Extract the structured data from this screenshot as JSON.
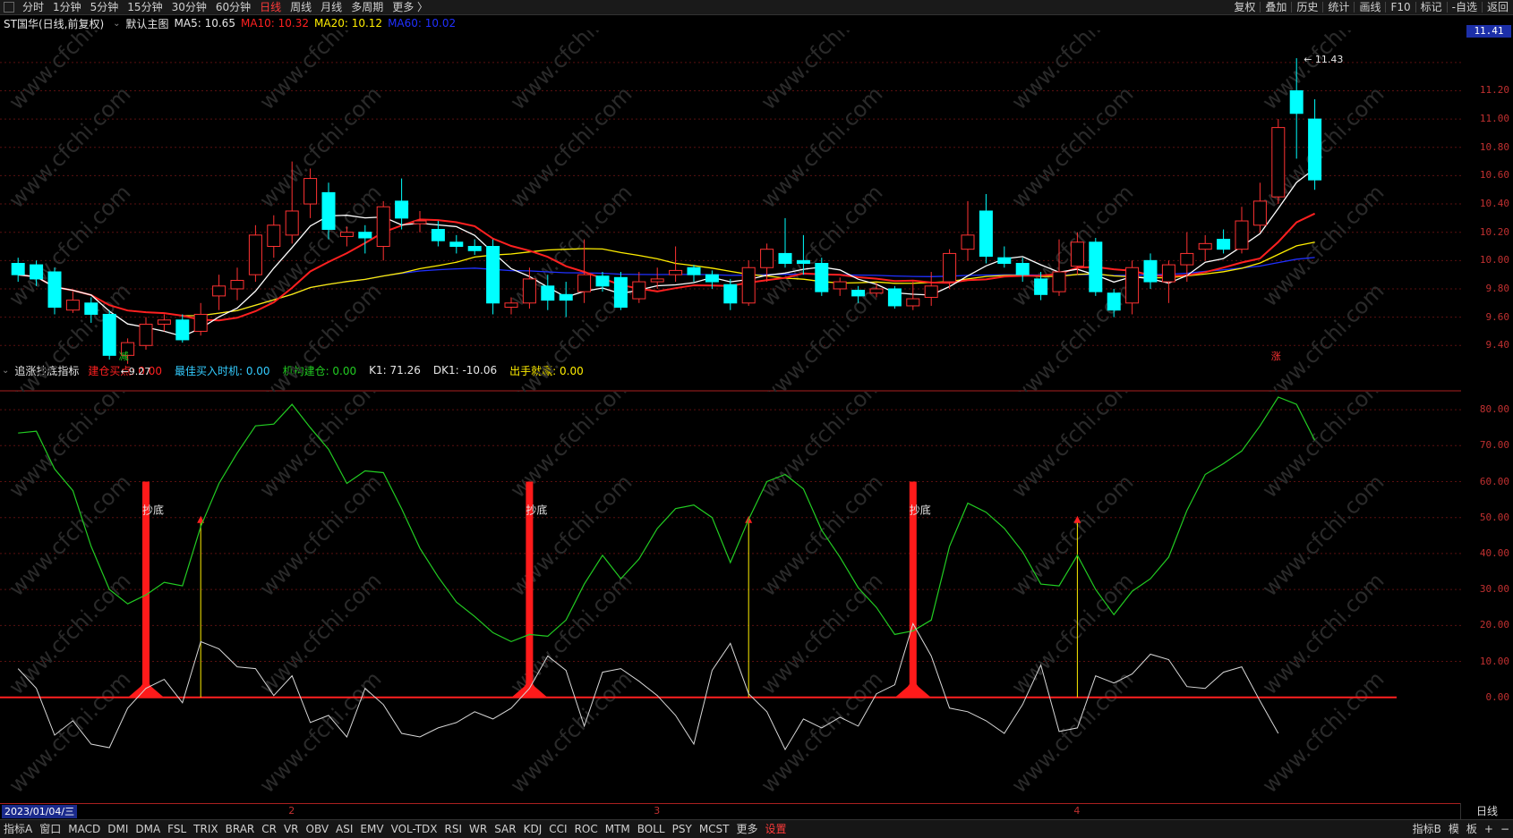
{
  "toolbar": {
    "periods": [
      {
        "label": "分时",
        "active": false
      },
      {
        "label": "1分钟",
        "active": false
      },
      {
        "label": "5分钟",
        "active": false
      },
      {
        "label": "15分钟",
        "active": false
      },
      {
        "label": "30分钟",
        "active": false
      },
      {
        "label": "60分钟",
        "active": false
      },
      {
        "label": "日线",
        "active": true
      },
      {
        "label": "周线",
        "active": false
      },
      {
        "label": "月线",
        "active": false
      },
      {
        "label": "多周期",
        "active": false
      },
      {
        "label": "更多 〉",
        "active": false
      }
    ],
    "right": [
      "复权",
      "叠加",
      "历史",
      "统计",
      "画线",
      "F10",
      "标记",
      "-自选",
      "返回"
    ]
  },
  "main_legend": {
    "stock": "ST国华(日线,前复权)",
    "main_indicator": "默认主图",
    "ma5": "MA5: 10.65",
    "ma10": "MA10: 10.32",
    "ma20": "MA20: 10.12",
    "ma60": "MA60: 10.02"
  },
  "sub_legend": {
    "name": "追涨抄底指标",
    "items": [
      {
        "text": "建仓买点: 0.00",
        "color": "#ff2020"
      },
      {
        "text": "最佳买入时机: 0.00",
        "color": "#33ccff"
      },
      {
        "text": "机构建仓: 0.00",
        "color": "#22cc22"
      },
      {
        "text": "K1: 71.26",
        "color": "#e6e6e6"
      },
      {
        "text": "DK1: -10.06",
        "color": "#e6e6e6"
      },
      {
        "text": "出手就赢: 0.00",
        "color": "#ffee00"
      }
    ]
  },
  "colors": {
    "up": "#ff3232",
    "down": "#00ffff",
    "ma5": "#ffffff",
    "ma10": "#ff2020",
    "ma20": "#ffee00",
    "ma60": "#2030ff",
    "k1": "#22cc22",
    "dk1": "#d8d8d8"
  },
  "price_axis": {
    "ticks": [
      "11.41",
      "11.20",
      "11.00",
      "10.80",
      "10.60",
      "10.40",
      "10.20",
      "10.00",
      "9.80",
      "9.60",
      "9.40"
    ],
    "current_price": "11.41"
  },
  "sub_axis": {
    "ticks": [
      "80.00",
      "70.00",
      "60.00",
      "50.00",
      "40.00",
      "30.00",
      "20.00",
      "10.00",
      "0.00"
    ]
  },
  "annotations": {
    "high_label": "11.43",
    "low_label": "9.27",
    "low_marker": "减",
    "up_marker": "涨",
    "bottom_label": "抄底"
  },
  "chart_data": {
    "type": "candlestick",
    "ylim": [
      9.25,
      11.5
    ],
    "candles": [
      [
        9.98,
        9.9,
        10.02,
        9.85
      ],
      [
        9.97,
        9.87,
        10.0,
        9.82
      ],
      [
        9.92,
        9.67,
        9.95,
        9.62
      ],
      [
        9.65,
        9.72,
        9.78,
        9.63
      ],
      [
        9.7,
        9.62,
        9.74,
        9.56
      ],
      [
        9.62,
        9.33,
        9.65,
        9.3
      ],
      [
        9.33,
        9.42,
        9.45,
        9.27
      ],
      [
        9.4,
        9.55,
        9.6,
        9.37
      ],
      [
        9.55,
        9.58,
        9.62,
        9.5
      ],
      [
        9.58,
        9.44,
        9.62,
        9.42
      ],
      [
        9.5,
        9.62,
        9.7,
        9.47
      ],
      [
        9.75,
        9.82,
        9.9,
        9.65
      ],
      [
        9.8,
        9.86,
        9.95,
        9.72
      ],
      [
        9.9,
        10.18,
        10.25,
        9.85
      ],
      [
        10.1,
        10.25,
        10.32,
        10.02
      ],
      [
        10.18,
        10.35,
        10.7,
        10.12
      ],
      [
        10.4,
        10.58,
        10.65,
        10.3
      ],
      [
        10.48,
        10.22,
        10.55,
        10.15
      ],
      [
        10.17,
        10.2,
        10.24,
        10.1
      ],
      [
        10.2,
        10.16,
        10.25,
        10.05
      ],
      [
        10.1,
        10.38,
        10.42,
        10.0
      ],
      [
        10.42,
        10.3,
        10.58,
        10.22
      ],
      [
        10.26,
        10.28,
        10.35,
        10.2
      ],
      [
        10.22,
        10.14,
        10.28,
        10.1
      ],
      [
        10.13,
        10.1,
        10.18,
        10.05
      ],
      [
        10.1,
        10.07,
        10.15,
        10.04
      ],
      [
        10.1,
        9.7,
        10.15,
        9.62
      ],
      [
        9.67,
        9.7,
        9.74,
        9.62
      ],
      [
        9.7,
        9.87,
        9.95,
        9.66
      ],
      [
        9.82,
        9.72,
        9.9,
        9.65
      ],
      [
        9.76,
        9.72,
        9.85,
        9.6
      ],
      [
        9.78,
        9.9,
        10.15,
        9.7
      ],
      [
        9.89,
        9.82,
        9.92,
        9.78
      ],
      [
        9.88,
        9.67,
        9.92,
        9.65
      ],
      [
        9.73,
        9.85,
        9.92,
        9.7
      ],
      [
        9.85,
        9.87,
        9.95,
        9.8
      ],
      [
        9.9,
        9.93,
        10.1,
        9.85
      ],
      [
        9.95,
        9.9,
        9.97,
        9.85
      ],
      [
        9.9,
        9.85,
        9.93,
        9.8
      ],
      [
        9.83,
        9.7,
        9.87,
        9.65
      ],
      [
        9.7,
        9.95,
        10.0,
        9.68
      ],
      [
        9.95,
        10.08,
        10.12,
        9.85
      ],
      [
        10.05,
        9.98,
        10.3,
        9.95
      ],
      [
        10.0,
        9.98,
        10.18,
        9.9
      ],
      [
        9.98,
        9.78,
        10.02,
        9.75
      ],
      [
        9.8,
        9.85,
        9.88,
        9.75
      ],
      [
        9.79,
        9.75,
        9.82,
        9.7
      ],
      [
        9.77,
        9.8,
        9.84,
        9.74
      ],
      [
        9.8,
        9.68,
        9.82,
        9.66
      ],
      [
        9.68,
        9.73,
        9.85,
        9.65
      ],
      [
        9.74,
        9.82,
        9.92,
        9.68
      ],
      [
        9.85,
        10.05,
        10.08,
        9.8
      ],
      [
        10.08,
        10.18,
        10.42,
        10.0
      ],
      [
        10.35,
        10.03,
        10.47,
        9.98
      ],
      [
        10.02,
        9.98,
        10.1,
        9.95
      ],
      [
        9.98,
        9.9,
        10.02,
        9.85
      ],
      [
        9.87,
        9.76,
        9.92,
        9.72
      ],
      [
        9.78,
        9.92,
        10.15,
        9.75
      ],
      [
        9.96,
        10.13,
        10.2,
        9.9
      ],
      [
        10.13,
        9.78,
        10.16,
        9.75
      ],
      [
        9.77,
        9.65,
        9.8,
        9.6
      ],
      [
        9.7,
        9.95,
        10.0,
        9.62
      ],
      [
        10.0,
        9.85,
        10.05,
        9.8
      ],
      [
        9.85,
        9.97,
        10.0,
        9.7
      ],
      [
        9.97,
        10.05,
        10.2,
        9.85
      ],
      [
        10.08,
        10.12,
        10.18,
        10.0
      ],
      [
        10.15,
        10.08,
        10.22,
        10.05
      ],
      [
        10.08,
        10.28,
        10.38,
        10.05
      ],
      [
        10.25,
        10.42,
        10.55,
        10.2
      ],
      [
        10.45,
        10.94,
        11.0,
        10.4
      ],
      [
        11.2,
        11.04,
        11.43,
        10.72
      ],
      [
        11.0,
        10.57,
        11.14,
        10.5
      ]
    ],
    "k1": [
      73.5,
      74,
      63.5,
      57.5,
      42,
      30,
      26,
      28.5,
      32,
      31,
      47.5,
      59.5,
      68,
      75.5,
      76,
      81.5,
      75,
      69,
      59.5,
      63,
      62.5,
      52.5,
      41.5,
      33.5,
      26.5,
      22.5,
      18,
      15.5,
      17.5,
      17,
      21.5,
      31.5,
      39.5,
      33,
      38.5,
      47,
      52.5,
      53.5,
      50,
      37.5,
      49.5,
      60,
      62,
      58,
      46.5,
      39,
      30.5,
      25,
      17.5,
      18.5,
      21.5,
      42,
      54,
      51.5,
      47,
      40.5,
      31.5,
      31,
      39.5,
      30,
      23,
      29.5,
      33,
      39,
      52,
      62,
      65,
      68.5,
      75.5,
      83.5,
      81.5,
      71.5
    ],
    "dk1": [
      8,
      2.5,
      -10.5,
      -6.5,
      -13,
      -14,
      -3,
      2.5,
      5,
      -1.5,
      15.5,
      13.5,
      8.5,
      8,
      0.5,
      6,
      -7,
      -5,
      -11,
      2.5,
      -2,
      -10,
      -11,
      -8.5,
      -7,
      -4,
      -6,
      -3,
      2.5,
      11.5,
      7.5,
      -8,
      7,
      8,
      4.5,
      0.5,
      -5,
      -13,
      7.5,
      15,
      1,
      -4,
      -14.5,
      -6,
      -8.5,
      -5.5,
      -8,
      1,
      3.5,
      20.5,
      11.5,
      -3,
      -4,
      -6.5,
      -10,
      -2,
      9,
      -9.5,
      -8.5,
      6,
      4,
      6.5,
      12,
      10.5,
      3,
      2.5,
      7,
      8.5,
      -1,
      -10
    ],
    "bottom_signals": [
      7,
      28,
      49
    ],
    "rise_signals": [
      10,
      40,
      58
    ]
  },
  "date_axis": {
    "date": "2023/01/04/三",
    "marks": [
      {
        "label": "2",
        "idx": 15
      },
      {
        "label": "3",
        "idx": 35
      },
      {
        "label": "4",
        "idx": 58
      }
    ]
  },
  "bottom_bar": {
    "items": [
      {
        "label": "指标A",
        "active": false
      },
      {
        "label": "窗口",
        "active": false
      },
      {
        "label": "MACD",
        "active": false
      },
      {
        "label": "DMI",
        "active": false
      },
      {
        "label": "DMA",
        "active": false
      },
      {
        "label": "FSL",
        "active": false
      },
      {
        "label": "TRIX",
        "active": false
      },
      {
        "label": "BRAR",
        "active": false
      },
      {
        "label": "CR",
        "active": false
      },
      {
        "label": "VR",
        "active": false
      },
      {
        "label": "OBV",
        "active": false
      },
      {
        "label": "ASI",
        "active": false
      },
      {
        "label": "EMV",
        "active": false
      },
      {
        "label": "VOL-TDX",
        "active": false
      },
      {
        "label": "RSI",
        "active": false
      },
      {
        "label": "WR",
        "active": false
      },
      {
        "label": "SAR",
        "active": false
      },
      {
        "label": "KDJ",
        "active": false
      },
      {
        "label": "CCI",
        "active": false
      },
      {
        "label": "ROC",
        "active": false
      },
      {
        "label": "MTM",
        "active": false
      },
      {
        "label": "BOLL",
        "active": false
      },
      {
        "label": "PSY",
        "active": false
      },
      {
        "label": "MCST",
        "active": false
      },
      {
        "label": "更多",
        "active": false
      },
      {
        "label": "设置",
        "active": true
      }
    ],
    "right": [
      "指标B",
      "模",
      "板",
      "+",
      "−"
    ]
  },
  "daily_tab": "日线"
}
